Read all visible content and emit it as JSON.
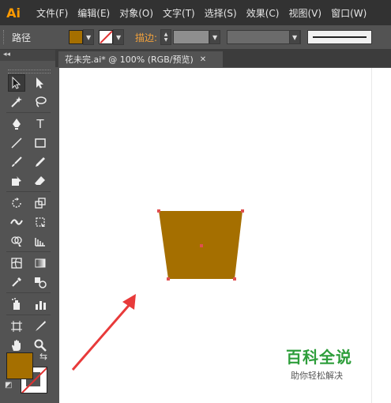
{
  "app": {
    "logo": "Ai"
  },
  "menu": [
    "文件(F)",
    "编辑(E)",
    "对象(O)",
    "文字(T)",
    "选择(S)",
    "效果(C)",
    "视图(V)",
    "窗口(W)"
  ],
  "control_bar": {
    "selection_label": "路径",
    "stroke_label": "描边:",
    "fill_color": "#a56f00",
    "stroke_color": "none"
  },
  "panel_collapse": "◂◂",
  "document_tab": {
    "title": "花未完.ai* @ 100% (RGB/预览)",
    "close": "✕"
  },
  "canvas": {
    "shape_fill": "#a56f00",
    "anchor_color": "#e05050",
    "arrow_color": "#e83a3a"
  },
  "tools": {
    "type_label": "T",
    "swap_glyph": "⇆",
    "reset_glyph": "◩"
  },
  "watermark": {
    "title": "百科全说",
    "subtitle": "助你轻松解决"
  }
}
